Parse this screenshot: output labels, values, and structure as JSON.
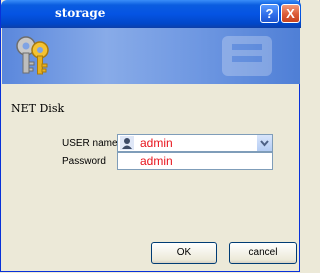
{
  "window": {
    "title": "storage",
    "help_label": "?",
    "close_label": "X"
  },
  "banner": {
    "icon": "keys-icon"
  },
  "form": {
    "section_title": "NET Disk",
    "username_label": "USER name",
    "username_value": "admin",
    "password_label": "Password",
    "password_value": "admin"
  },
  "buttons": {
    "ok_label": "OK",
    "cancel_label": "cancel"
  },
  "colors": {
    "title_bar": "#0554e3",
    "value_text": "#e8141c",
    "window_bg": "#ece9d8"
  }
}
